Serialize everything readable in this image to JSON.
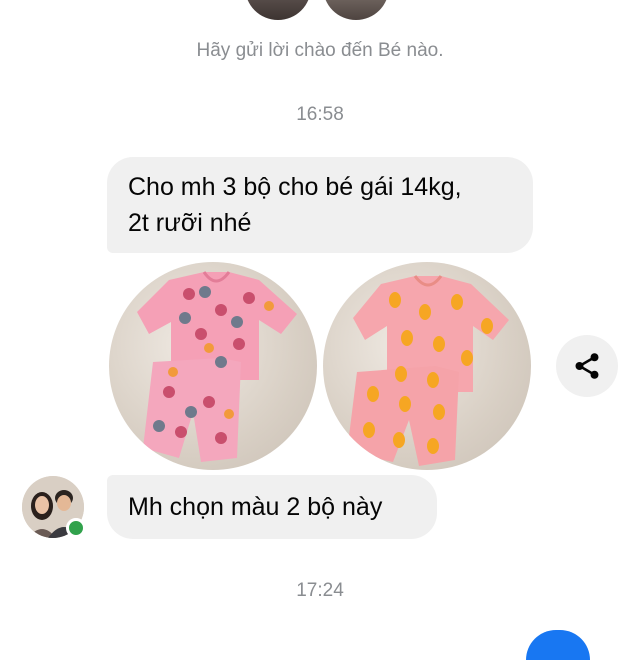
{
  "conversation": {
    "greeting": "Hãy gửi lời chào đến Bé nào.",
    "timestamps": [
      "16:58",
      "17:24"
    ],
    "messages": [
      {
        "text_line1": "Cho mh 3 bộ cho bé gái 14kg,",
        "text_line2": "2t rưỡi nhé"
      },
      {
        "text": "Mh chọn màu 2 bộ này"
      }
    ]
  },
  "photos": [
    {
      "description_icon": "pink-pajama-set-photo",
      "fabric_color": "#f5a0b6",
      "print_color": "#c94f6d"
    },
    {
      "description_icon": "orange-pajama-set-photo",
      "fabric_color": "#f7a2a8",
      "print_color": "#f6a623"
    }
  ],
  "icons": {
    "share": "share-icon",
    "sender_avatar": "avatar",
    "online_status": "online-status-dot"
  },
  "colors": {
    "bubble": "#f0f0f0",
    "muted_text": "#8a8d91",
    "online": "#31a24c",
    "accent": "#1877f2"
  }
}
